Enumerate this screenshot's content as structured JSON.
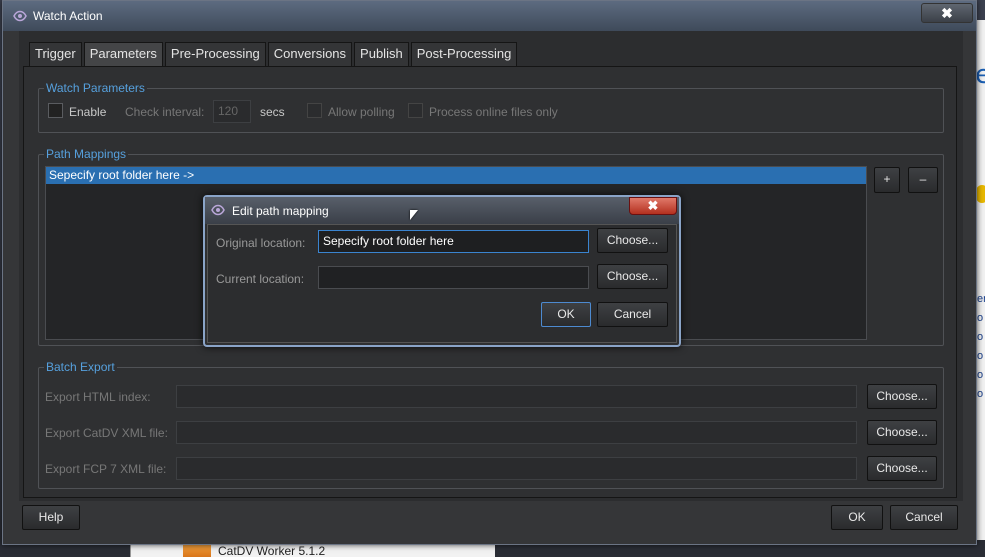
{
  "window": {
    "title": "Watch Action",
    "close_label": "✖"
  },
  "tabs": [
    {
      "label": "Trigger"
    },
    {
      "label": "Parameters"
    },
    {
      "label": "Pre-Processing"
    },
    {
      "label": "Conversions"
    },
    {
      "label": "Publish"
    },
    {
      "label": "Post-Processing"
    }
  ],
  "active_tab": "Parameters",
  "watch_parameters": {
    "title": "Watch Parameters",
    "enable_label": "Enable",
    "check_interval_label": "Check interval:",
    "check_interval_value": "120",
    "check_interval_unit": "secs",
    "allow_polling_label": "Allow polling",
    "process_online_label": "Process online files only"
  },
  "path_mappings": {
    "title": "Path Mappings",
    "rows": [
      "Sepecify root folder here ->"
    ],
    "add_label": "+",
    "remove_label": "–"
  },
  "edit_dialog": {
    "title": "Edit path mapping",
    "close_label": "✖",
    "original_label": "Original location:",
    "original_value": "Sepecify root folder here",
    "current_label": "Current location:",
    "current_value": "",
    "choose_label": "Choose...",
    "ok_label": "OK",
    "cancel_label": "Cancel"
  },
  "batch_export": {
    "title": "Batch Export",
    "html_label": "Export HTML index:",
    "catdv_label": "Export CatDV XML file:",
    "fcp_label": "Export FCP 7 XML file:",
    "choose_label": "Choose..."
  },
  "footer": {
    "help_label": "Help",
    "ok_label": "OK",
    "cancel_label": "Cancel"
  },
  "background": {
    "taskbar_item": "CatDV Worker 5.1.2",
    "right_letter": "e",
    "side_letters": [
      "er",
      "o",
      "o",
      "o",
      "o",
      "o"
    ]
  },
  "colors": {
    "accent": "#56a0dd",
    "selection": "#2a6fb1",
    "close_red": "#c8402e"
  }
}
